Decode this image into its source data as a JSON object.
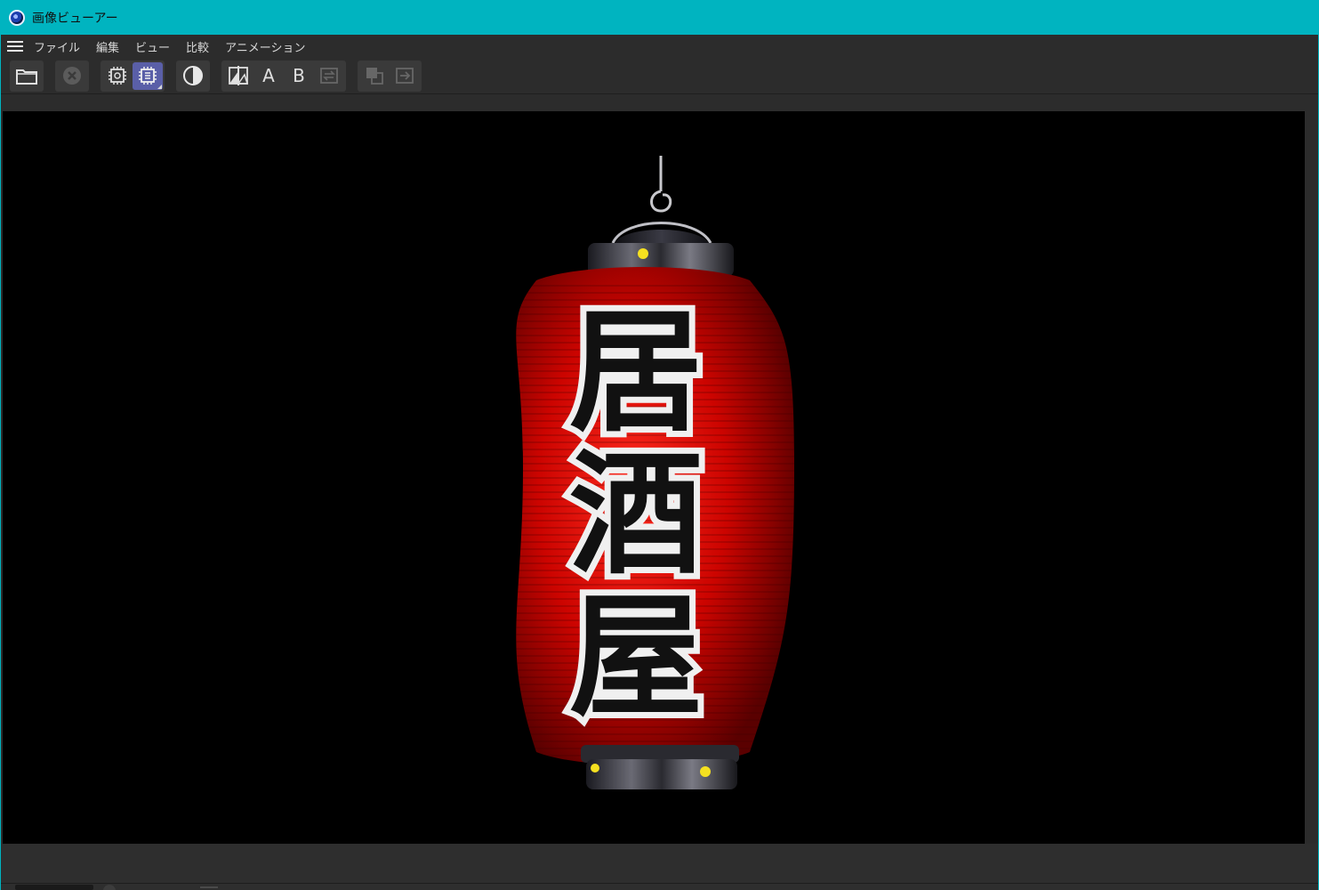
{
  "window": {
    "title": "画像ビューアー",
    "accent": "#00b4c0"
  },
  "menu": {
    "items": [
      {
        "id": "file",
        "label": "ファイル"
      },
      {
        "id": "edit",
        "label": "編集"
      },
      {
        "id": "view",
        "label": "ビュー"
      },
      {
        "id": "compare",
        "label": "比較"
      },
      {
        "id": "animation",
        "label": "アニメーション"
      }
    ]
  },
  "toolbar": {
    "groups": [
      [
        {
          "id": "open",
          "icon": "folder-icon",
          "state": "normal"
        }
      ],
      [
        {
          "id": "close",
          "icon": "close-circle-icon",
          "state": "disabled"
        }
      ],
      [
        {
          "id": "render-a",
          "icon": "cpu-gear-icon",
          "state": "normal"
        },
        {
          "id": "render-b",
          "icon": "cpu-chip-icon",
          "state": "active"
        }
      ],
      [
        {
          "id": "contrast",
          "icon": "half-circle-icon",
          "state": "normal"
        }
      ],
      [
        {
          "id": "split",
          "icon": "split-compare-icon",
          "state": "normal"
        },
        {
          "id": "slot-a",
          "letter": "A",
          "state": "normal"
        },
        {
          "id": "slot-b",
          "letter": "B",
          "state": "normal"
        },
        {
          "id": "swap",
          "icon": "swap-icon",
          "state": "disabled"
        }
      ],
      [
        {
          "id": "overlay",
          "icon": "overlay-icon",
          "state": "disabled"
        },
        {
          "id": "export",
          "icon": "export-icon",
          "state": "disabled"
        }
      ]
    ]
  },
  "image": {
    "lantern_text": [
      "居",
      "酒",
      "屋"
    ],
    "colors": {
      "paper": "#c80000",
      "frame": "#3a3a40",
      "rivet": "#f5e020"
    }
  }
}
